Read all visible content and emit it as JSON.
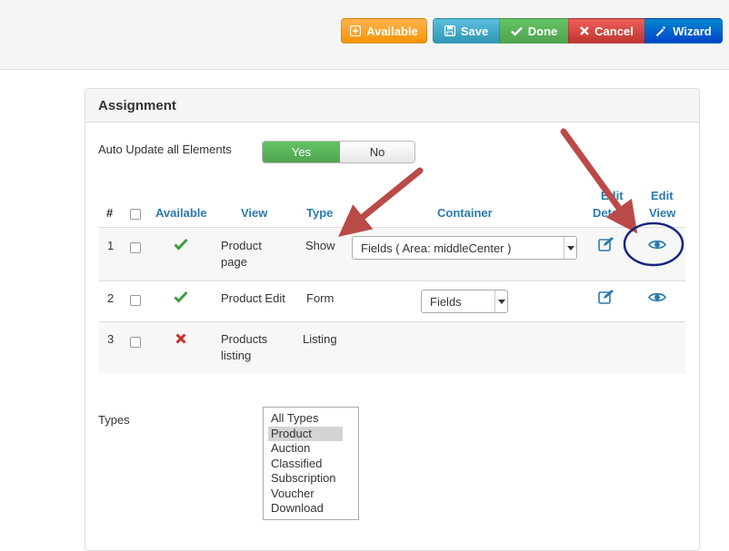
{
  "toolbar": {
    "available": "Available",
    "save": "Save",
    "done": "Done",
    "cancel": "Cancel",
    "wizard": "Wizard"
  },
  "panel": {
    "title": "Assignment",
    "auto_update_label": "Auto Update all Elements",
    "toggle": {
      "yes": "Yes",
      "no": "No",
      "selected": "Yes"
    }
  },
  "table": {
    "headers": {
      "num": "#",
      "available": "Available",
      "view": "View",
      "type": "Type",
      "container": "Container",
      "edit_details_1": "Edit",
      "edit_details_2": "Details",
      "edit_view_1": "Edit",
      "edit_view_2": "View"
    },
    "rows": [
      {
        "num": "1",
        "available": "yes",
        "view_1": "Product",
        "view_2": "page",
        "type": "Show",
        "container": "Fields ( Area: middleCenter )"
      },
      {
        "num": "2",
        "available": "yes",
        "view_1": "Product Edit",
        "view_2": "",
        "type": "Form",
        "container": "Fields"
      },
      {
        "num": "3",
        "available": "no",
        "view_1": "Products",
        "view_2": "listing",
        "type": "Listing",
        "container": ""
      }
    ]
  },
  "types": {
    "label": "Types",
    "options": [
      "All Types",
      "Product",
      "Auction",
      "Classified",
      "Subscription",
      "Voucher",
      "Download"
    ],
    "selected": "Product"
  },
  "colors": {
    "link_blue": "#2a7ab0",
    "check_green": "#3c9a3c",
    "cross_red": "#c9302c",
    "arrow_red": "#b94a48",
    "circle_navy": "#1a237e"
  }
}
